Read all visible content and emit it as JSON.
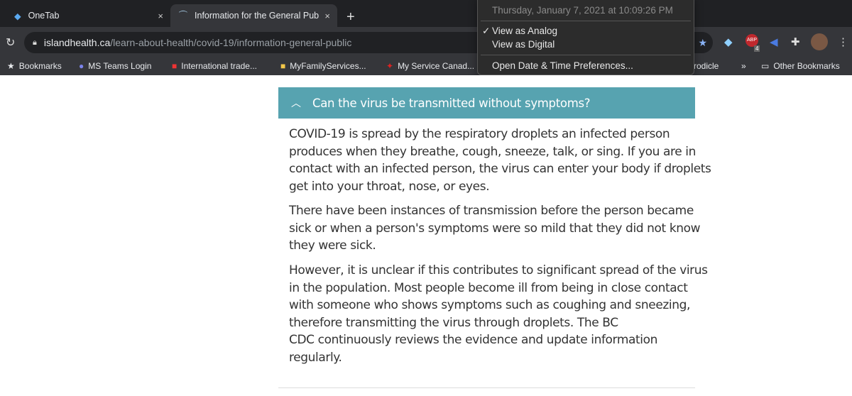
{
  "browser": {
    "tabs": [
      {
        "label": "OneTab",
        "icon": "diamond-icon",
        "active": false
      },
      {
        "label": "Information for the General Pub",
        "icon": "island-health-icon",
        "active": true
      }
    ],
    "new_tab": "+",
    "close": "×",
    "url_host": "islandhealth.ca",
    "url_path": "/learn-about-health/covid-19/information-general-public",
    "extension_badge": "4",
    "bookmarks": [
      {
        "label": "Bookmarks"
      },
      {
        "label": "MS Teams Login"
      },
      {
        "label": "International trade..."
      },
      {
        "label": "MyFamilyServices..."
      },
      {
        "label": "My Service Canad..."
      },
      {
        "label": "rodicle"
      }
    ],
    "more": "»",
    "other_bookmarks": "Other Bookmarks"
  },
  "clock_menu": {
    "date": "Thursday, January 7, 2021 at 10:09:26 PM",
    "items": [
      {
        "label": "View as Analog",
        "checked": true
      },
      {
        "label": "View as Digital",
        "checked": false
      }
    ],
    "check": "✓",
    "prefs": "Open Date & Time Preferences..."
  },
  "page": {
    "accordion_title": "Can the virus be transmitted without symptoms?",
    "accent_color": "#57a3b0",
    "paragraphs": [
      [
        "COVID-19 is spread by the respiratory droplets an infected person",
        "produces when they breathe, cough, sneeze, talk, or sing. If you are in",
        "contact with an infected person, the virus can enter your body if droplets",
        "get into your throat, nose, or eyes."
      ],
      [
        "There have been instances of transmission before the person became",
        "sick or when a person's symptoms were so mild that they did not know",
        "they were sick."
      ],
      [
        "However, it is unclear if this contributes to significant spread of the virus",
        "in the population. Most people become ill from being in close contact",
        "with someone who shows symptoms such as coughing and sneezing,",
        "therefore transmitting the virus through droplets. The BC",
        "CDC continuously reviews the evidence and update information",
        "regularly."
      ]
    ]
  }
}
